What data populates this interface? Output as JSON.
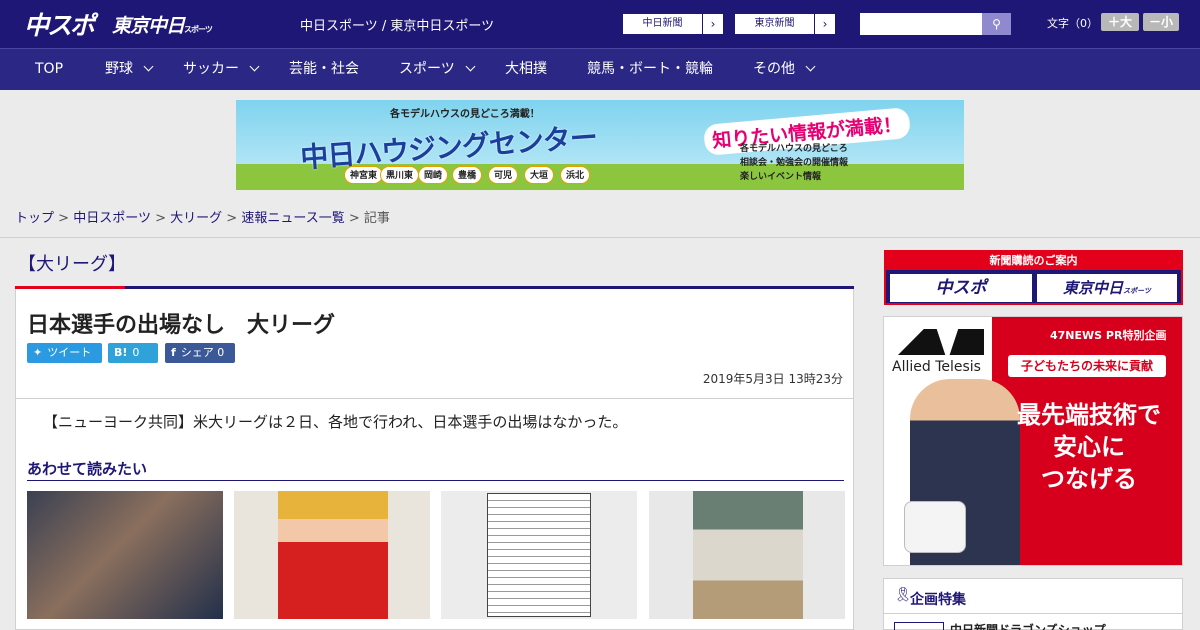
{
  "header": {
    "logo_chunichi_sports": "中スポ",
    "logo_tokyo_chunichi": "東京中日",
    "logo_tokyo_chunichi_suffix": "スポーツ",
    "site_title": "中日スポーツ / 東京中日スポーツ",
    "paper_buttons": [
      {
        "label": "中日新聞"
      },
      {
        "label": "東京新聞"
      }
    ],
    "search_placeholder": "",
    "font_size_label": "文字（0）",
    "font_plus": "＋大",
    "font_minus": "－小"
  },
  "nav": {
    "items": [
      {
        "label": "TOP",
        "dropdown": false
      },
      {
        "label": "野球",
        "dropdown": true
      },
      {
        "label": "サッカー",
        "dropdown": true
      },
      {
        "label": "芸能・社会",
        "dropdown": false
      },
      {
        "label": "スポーツ",
        "dropdown": true
      },
      {
        "label": "大相撲",
        "dropdown": false
      },
      {
        "label": "競馬・ボート・競輪",
        "dropdown": false
      },
      {
        "label": "その他",
        "dropdown": true
      }
    ]
  },
  "banner": {
    "top_text": "各モデルハウスの見どころ満載！",
    "main_text": "中日ハウジングセンター",
    "right_text": "知りたい情報が満載！",
    "list": [
      "各モデルハウスの見どころ",
      "相談会・勉強会の開催情報",
      "楽しいイベント情報"
    ],
    "towns": [
      "神宮東",
      "黒川東",
      "岡崎",
      "豊橋",
      "可児",
      "大垣",
      "浜北"
    ]
  },
  "breadcrumb": {
    "items": [
      "トップ",
      "中日スポーツ",
      "大リーグ",
      "速報ニュース一覧"
    ],
    "current": "記事",
    "separator": ">"
  },
  "article": {
    "category": "【大リーグ】",
    "title": "日本選手の出場なし　大リーグ",
    "share": {
      "tweet_label": "ツイート",
      "hatena_count": "0",
      "facebook_label": "シェア",
      "facebook_count": "0"
    },
    "date": "2019年5月3日 13時23分",
    "body": "【ニューヨーク共同】米大リーグは２日、各地で行われ、日本選手の出場はなかった。",
    "related_heading": "あわせて読みたい"
  },
  "sidebar": {
    "subscribe_title": "新聞購読のご案内",
    "subscribe_logos": [
      "中スポ",
      "東京中日"
    ],
    "subscribe_logo_suffix": "スポーツ",
    "ad": {
      "pr_label": "47NEWS PR特別企画",
      "brand": "Allied Telesis",
      "subhead": "子どもたちの未来に貢献",
      "lines": [
        "最先端技術で",
        "安心に",
        "つなげる"
      ]
    },
    "kikaku_title": "企画特集",
    "kikaku_item": "中日新聞ドラゴンズショップ"
  },
  "colors": {
    "brand_navy": "#1f1775",
    "nav_bg": "#2b2784",
    "accent_red": "#e2001a",
    "twitter": "#2b9ae0",
    "facebook": "#3b5998"
  }
}
